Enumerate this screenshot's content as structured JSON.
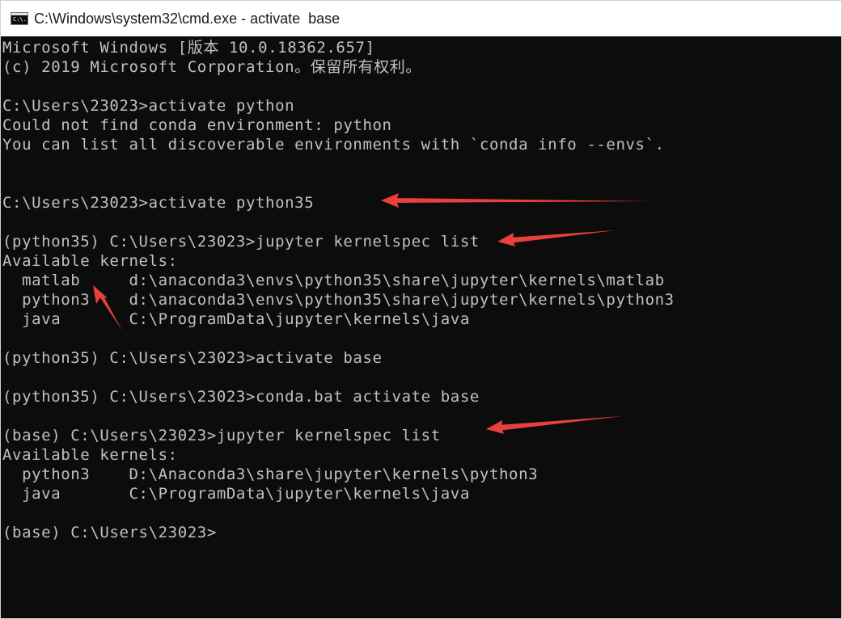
{
  "window": {
    "title": "C:\\Windows\\system32\\cmd.exe - activate  base",
    "icon": "cmd-icon",
    "icon_glyph": "C:\\."
  },
  "console": {
    "background": "#0c0c0c",
    "text_color": "#c0c0c0",
    "lines": [
      "Microsoft Windows [版本 10.0.18362.657]",
      "(c) 2019 Microsoft Corporation。保留所有权利。",
      "",
      "C:\\Users\\23023>activate python",
      "Could not find conda environment: python",
      "You can list all discoverable environments with `conda info --envs`.",
      "",
      "",
      "C:\\Users\\23023>activate python35",
      "",
      "(python35) C:\\Users\\23023>jupyter kernelspec list",
      "Available kernels:",
      "  matlab     d:\\anaconda3\\envs\\python35\\share\\jupyter\\kernels\\matlab",
      "  python3    d:\\anaconda3\\envs\\python35\\share\\jupyter\\kernels\\python3",
      "  java       C:\\ProgramData\\jupyter\\kernels\\java",
      "",
      "(python35) C:\\Users\\23023>activate base",
      "",
      "(python35) C:\\Users\\23023>conda.bat activate base",
      "",
      "(base) C:\\Users\\23023>jupyter kernelspec list",
      "Available kernels:",
      "  python3    D:\\Anaconda3\\share\\jupyter\\kernels\\python3",
      "  java       C:\\ProgramData\\jupyter\\kernels\\java",
      "",
      "(base) C:\\Users\\23023>"
    ]
  },
  "annotations": {
    "arrow_color": "#e8403a",
    "arrows": [
      "arrow-activate-python35",
      "arrow-kernelspec-list-python35",
      "arrow-matlab-kernel",
      "arrow-kernelspec-list-base"
    ]
  }
}
